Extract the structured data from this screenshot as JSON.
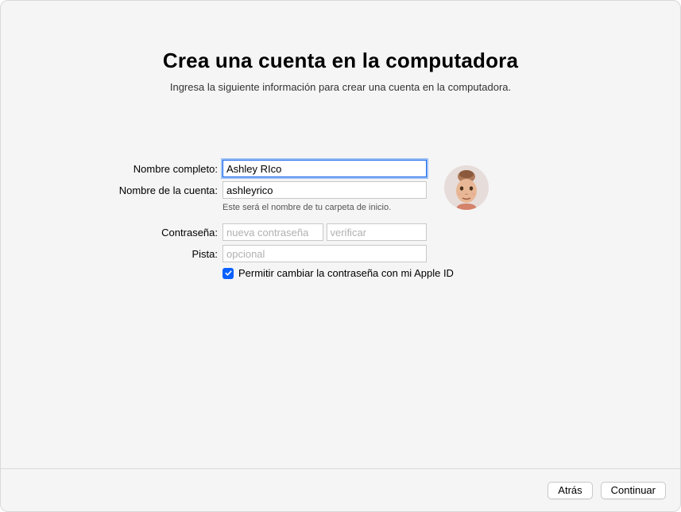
{
  "header": {
    "title": "Crea una cuenta en la computadora",
    "subtitle": "Ingresa la siguiente información para crear una cuenta en la computadora."
  },
  "form": {
    "fullNameLabel": "Nombre completo:",
    "fullNameValue": "Ashley RIco",
    "accountNameLabel": "Nombre de la cuenta:",
    "accountNameValue": "ashleyrico",
    "accountNameHint": "Este será el nombre de tu carpeta de inicio.",
    "passwordLabel": "Contraseña:",
    "passwordPlaceholder": "nueva contraseña",
    "passwordVerifyPlaceholder": "verificar",
    "hintLabel": "Pista:",
    "hintPlaceholder": "opcional",
    "allowAppleIdLabel": "Permitir cambiar la contraseña con mi Apple ID",
    "allowAppleIdChecked": true
  },
  "footer": {
    "back": "Atrás",
    "continue": "Continuar"
  }
}
